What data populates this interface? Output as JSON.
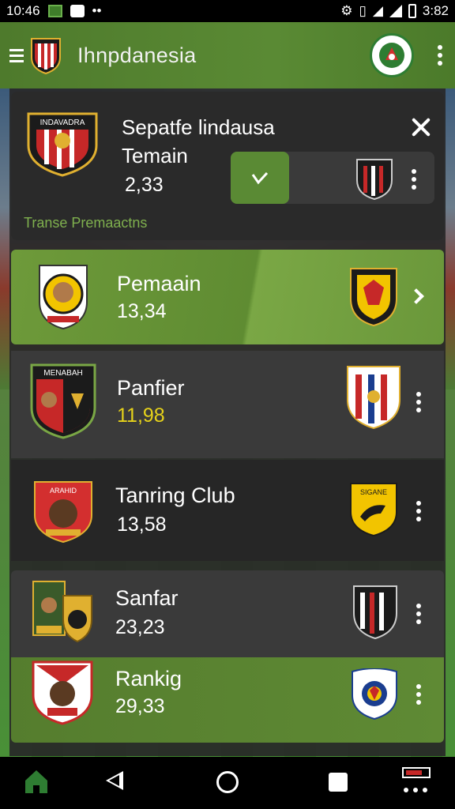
{
  "status_bar": {
    "time_left": "10:46",
    "time_right": "3:82"
  },
  "app_bar": {
    "title": "Ihnpdanesia"
  },
  "main_card": {
    "crest_text": "INDAVADRA",
    "title": "Sepatfe lindausa",
    "subtitle": "Temain",
    "value": "2,33",
    "caption": "Transe Premaactns"
  },
  "rows": [
    {
      "name": "Pemaain",
      "value": "13,34"
    },
    {
      "name": "Panfier",
      "value": "11,98",
      "value_color": "#e6d21a"
    },
    {
      "name": "Tanring Club",
      "value": "13,58"
    },
    {
      "name": "Sanfar",
      "value": "23,23"
    },
    {
      "name": "Rankig",
      "value": "29,33"
    }
  ],
  "crests": {
    "row2_left": "MENABAH",
    "row3_left": "ARAHID",
    "row3_right": "SIGANE"
  },
  "colors": {
    "accent_green": "#5a8a34",
    "caption_green": "#7fb04e",
    "highlight_yellow": "#e6d21a"
  }
}
